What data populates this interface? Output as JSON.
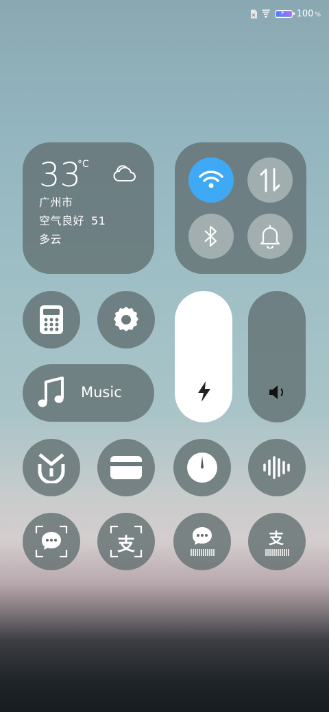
{
  "status_bar": {
    "sim_icon": "no-sim-icon",
    "signal_icon": "wifi-signal-icon",
    "battery_percent": "100",
    "battery_unit": "%"
  },
  "weather": {
    "temperature": "33",
    "unit": "°C",
    "city": "广州市",
    "air_quality": "空气良好",
    "aqi": "51",
    "condition": "多云",
    "icon": "cloud-icon"
  },
  "connectivity": {
    "wifi": {
      "icon": "wifi-icon",
      "active": true
    },
    "mobile_data": {
      "icon": "data-arrows-icon",
      "active": false
    },
    "bluetooth": {
      "icon": "bluetooth-icon",
      "active": false
    },
    "ring": {
      "icon": "bell-icon",
      "active": false
    }
  },
  "shortcuts_row1": [
    {
      "icon": "calculator-icon"
    },
    {
      "icon": "settings-gear-icon"
    }
  ],
  "music": {
    "label": "Music",
    "icon": "music-note-icon"
  },
  "sliders": {
    "brightness": {
      "icon": "flash-icon",
      "level": 1.0
    },
    "volume": {
      "icon": "speaker-icon",
      "level": 0.0
    }
  },
  "shortcuts_row3": [
    {
      "icon": "mi-home-icon"
    },
    {
      "icon": "card-icon"
    },
    {
      "icon": "compass-icon"
    },
    {
      "icon": "sound-wave-icon"
    }
  ],
  "shortcuts_row4": [
    {
      "icon": "wechat-scan-icon"
    },
    {
      "icon": "alipay-scan-icon"
    },
    {
      "icon": "wechat-pay-code-icon"
    },
    {
      "icon": "alipay-pay-code-icon"
    }
  ],
  "alipay_glyph": "支",
  "colors": {
    "accent_blue": "#3fa9f5",
    "panel": "#606e70",
    "tile_light": "rgba(190,200,200,0.65)"
  }
}
